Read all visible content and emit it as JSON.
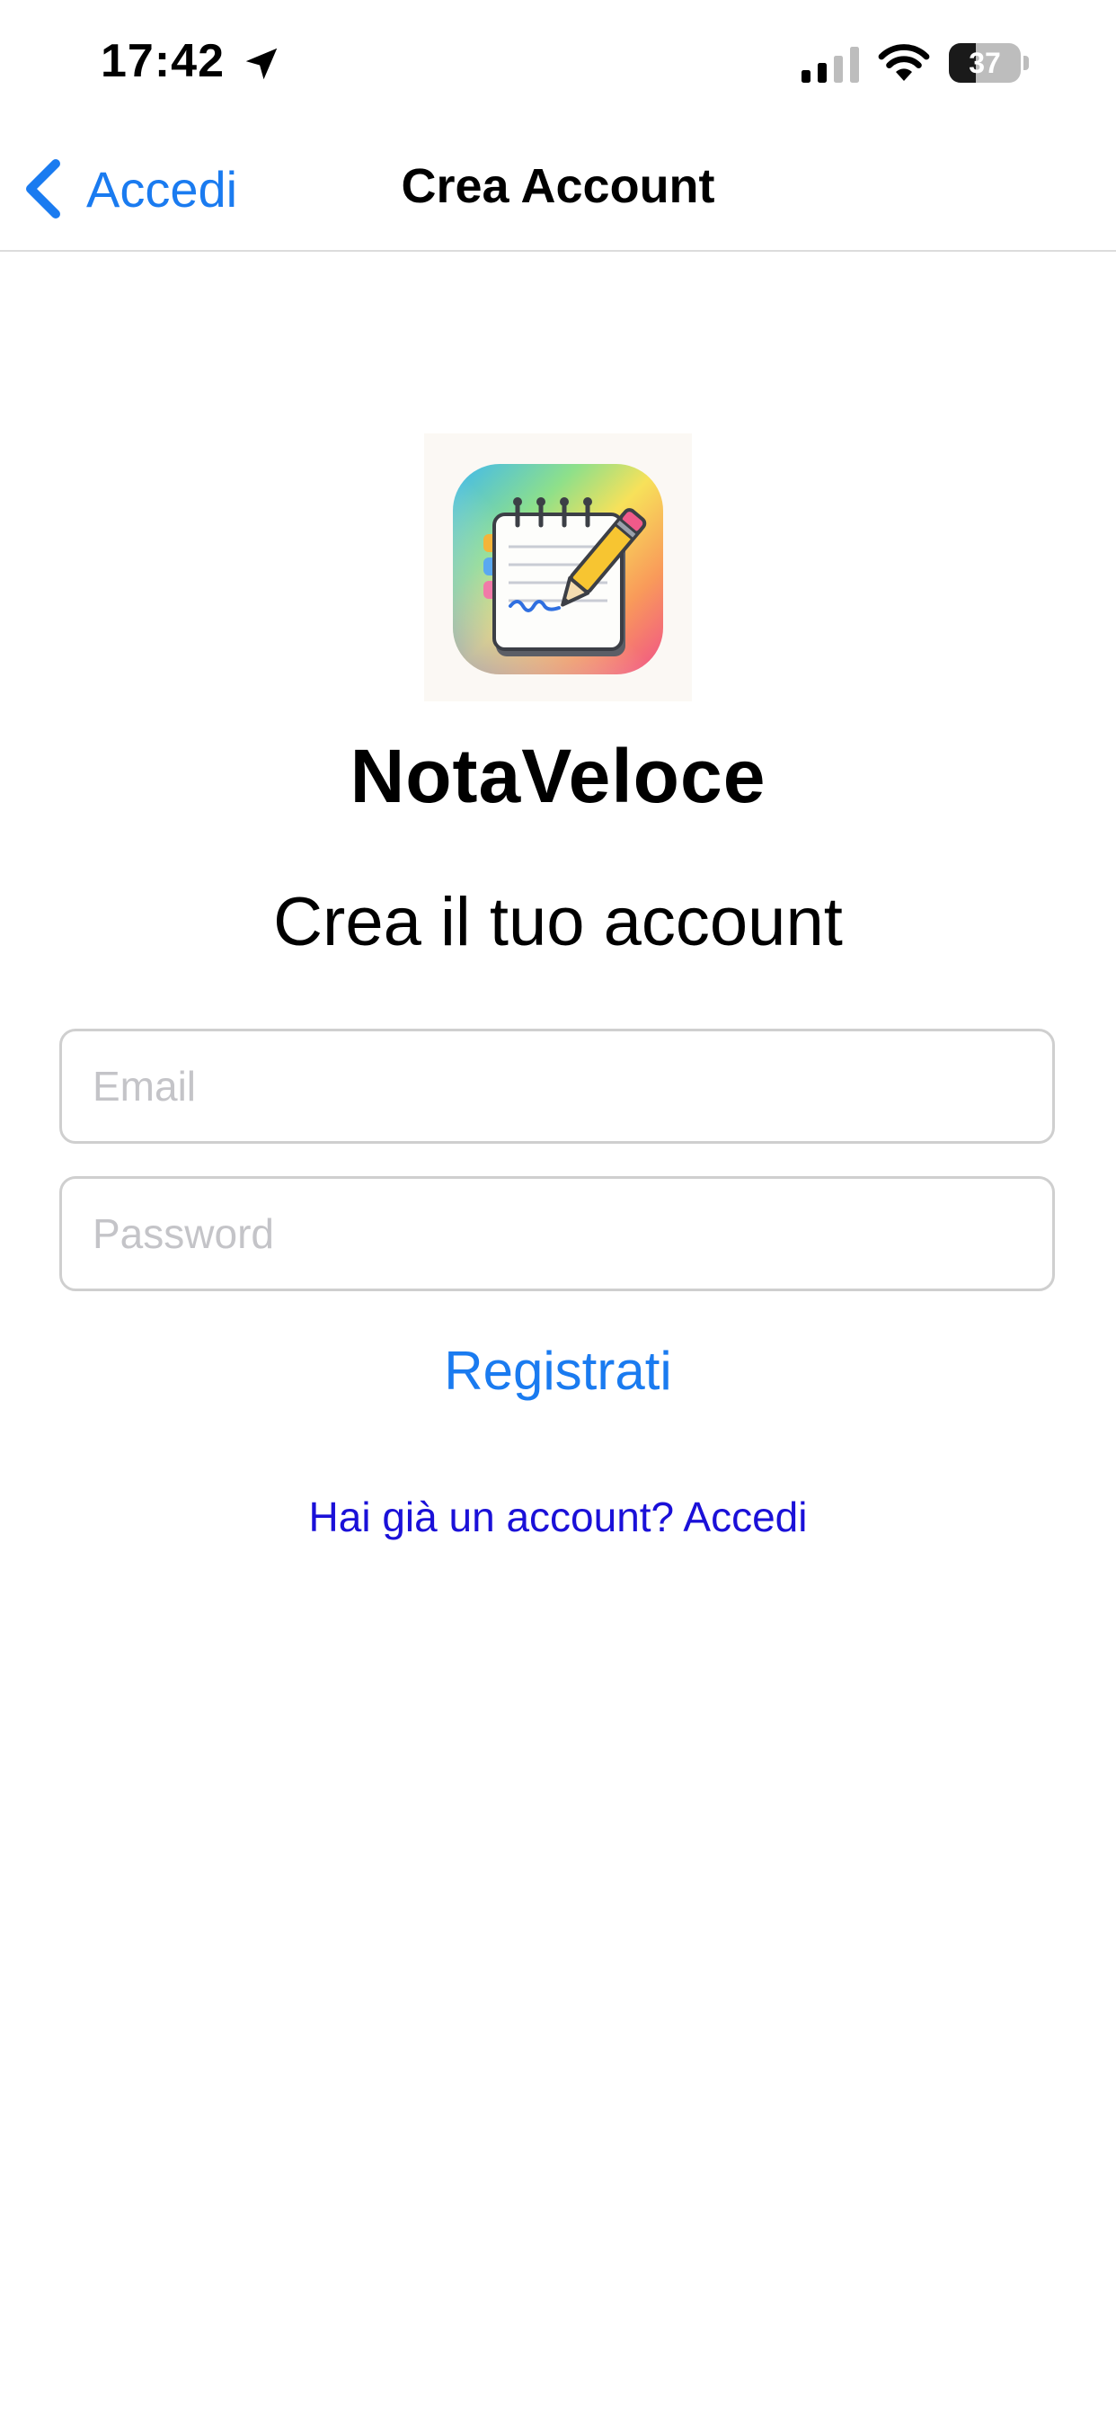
{
  "status_bar": {
    "time": "17:42",
    "battery_level": "37",
    "battery_fraction": 0.37
  },
  "nav": {
    "back_label": "Accedi",
    "title": "Crea Account"
  },
  "app": {
    "icon": "notepad-pencil-icon",
    "name": "NotaVeloce"
  },
  "form": {
    "heading": "Crea il tuo account",
    "email_placeholder": "Email",
    "email_value": "",
    "password_placeholder": "Password",
    "password_value": "",
    "register_label": "Registrati",
    "login_link": "Hai già un account? Accedi"
  },
  "colors": {
    "accent": "#1a7bf0",
    "link": "#1a10d8",
    "field_border": "#cfcfcf",
    "placeholder": "#c4c4c8"
  }
}
